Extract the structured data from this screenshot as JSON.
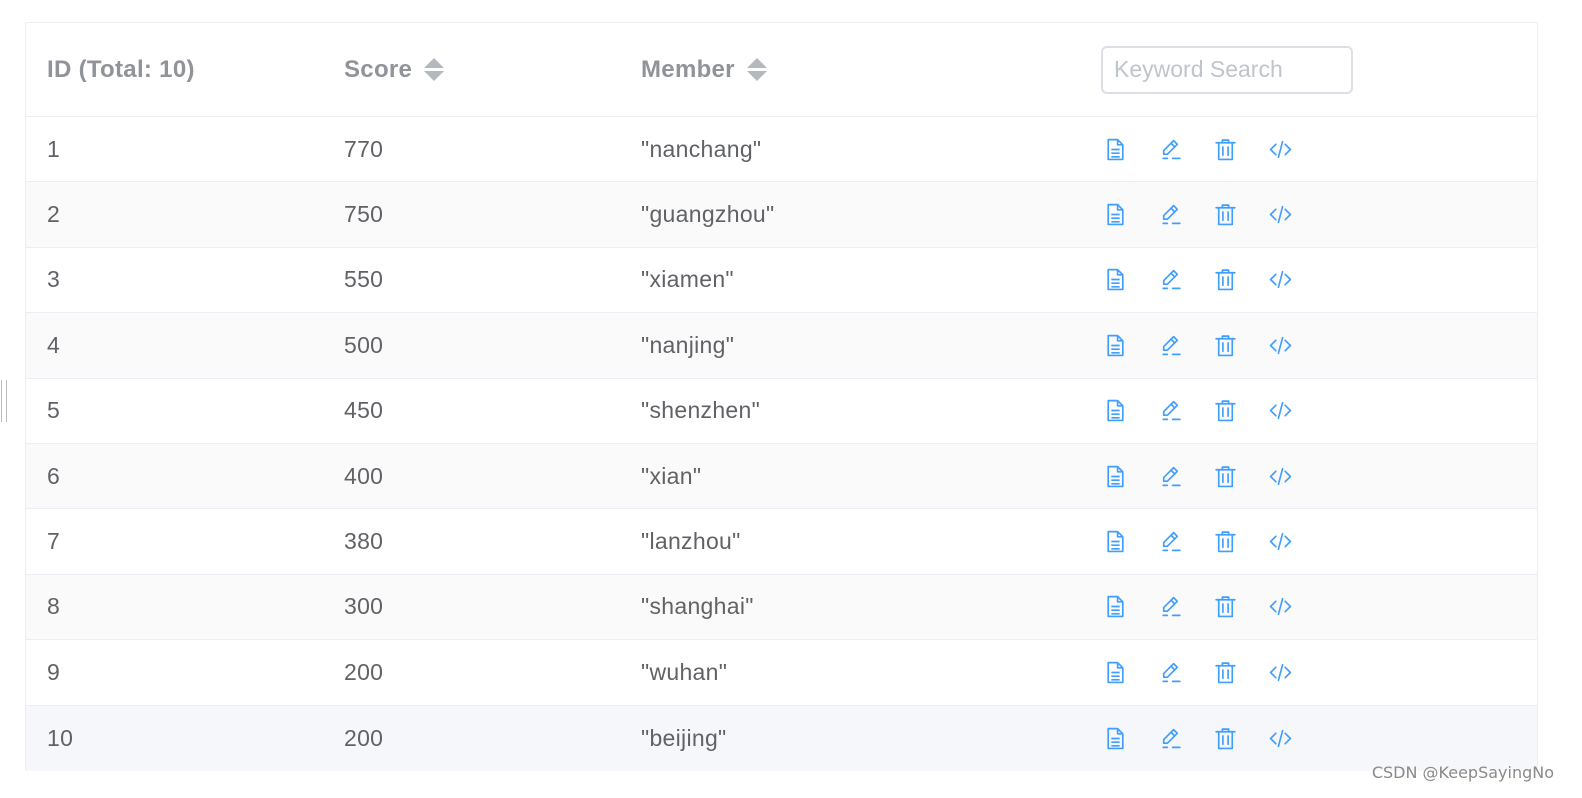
{
  "table": {
    "headers": {
      "id": "ID (Total: 10)",
      "score": "Score",
      "member": "Member"
    },
    "search": {
      "placeholder": "Keyword Search",
      "value": ""
    },
    "row_actions": [
      "document-icon",
      "edit-icon",
      "delete-icon",
      "code-icon"
    ],
    "accent_color": "#409eff",
    "rows": [
      {
        "id": "1",
        "score": "770",
        "member": "\"nanchang\""
      },
      {
        "id": "2",
        "score": "750",
        "member": "\"guangzhou\""
      },
      {
        "id": "3",
        "score": "550",
        "member": "\"xiamen\""
      },
      {
        "id": "4",
        "score": "500",
        "member": "\"nanjing\""
      },
      {
        "id": "5",
        "score": "450",
        "member": "\"shenzhen\""
      },
      {
        "id": "6",
        "score": "400",
        "member": "\"xian\""
      },
      {
        "id": "7",
        "score": "380",
        "member": "\"lanzhou\""
      },
      {
        "id": "8",
        "score": "300",
        "member": "\"shanghai\""
      },
      {
        "id": "9",
        "score": "200",
        "member": "\"wuhan\""
      },
      {
        "id": "10",
        "score": "200",
        "member": "\"beijing\""
      }
    ]
  },
  "watermark": "CSDN @KeepSayingNo"
}
